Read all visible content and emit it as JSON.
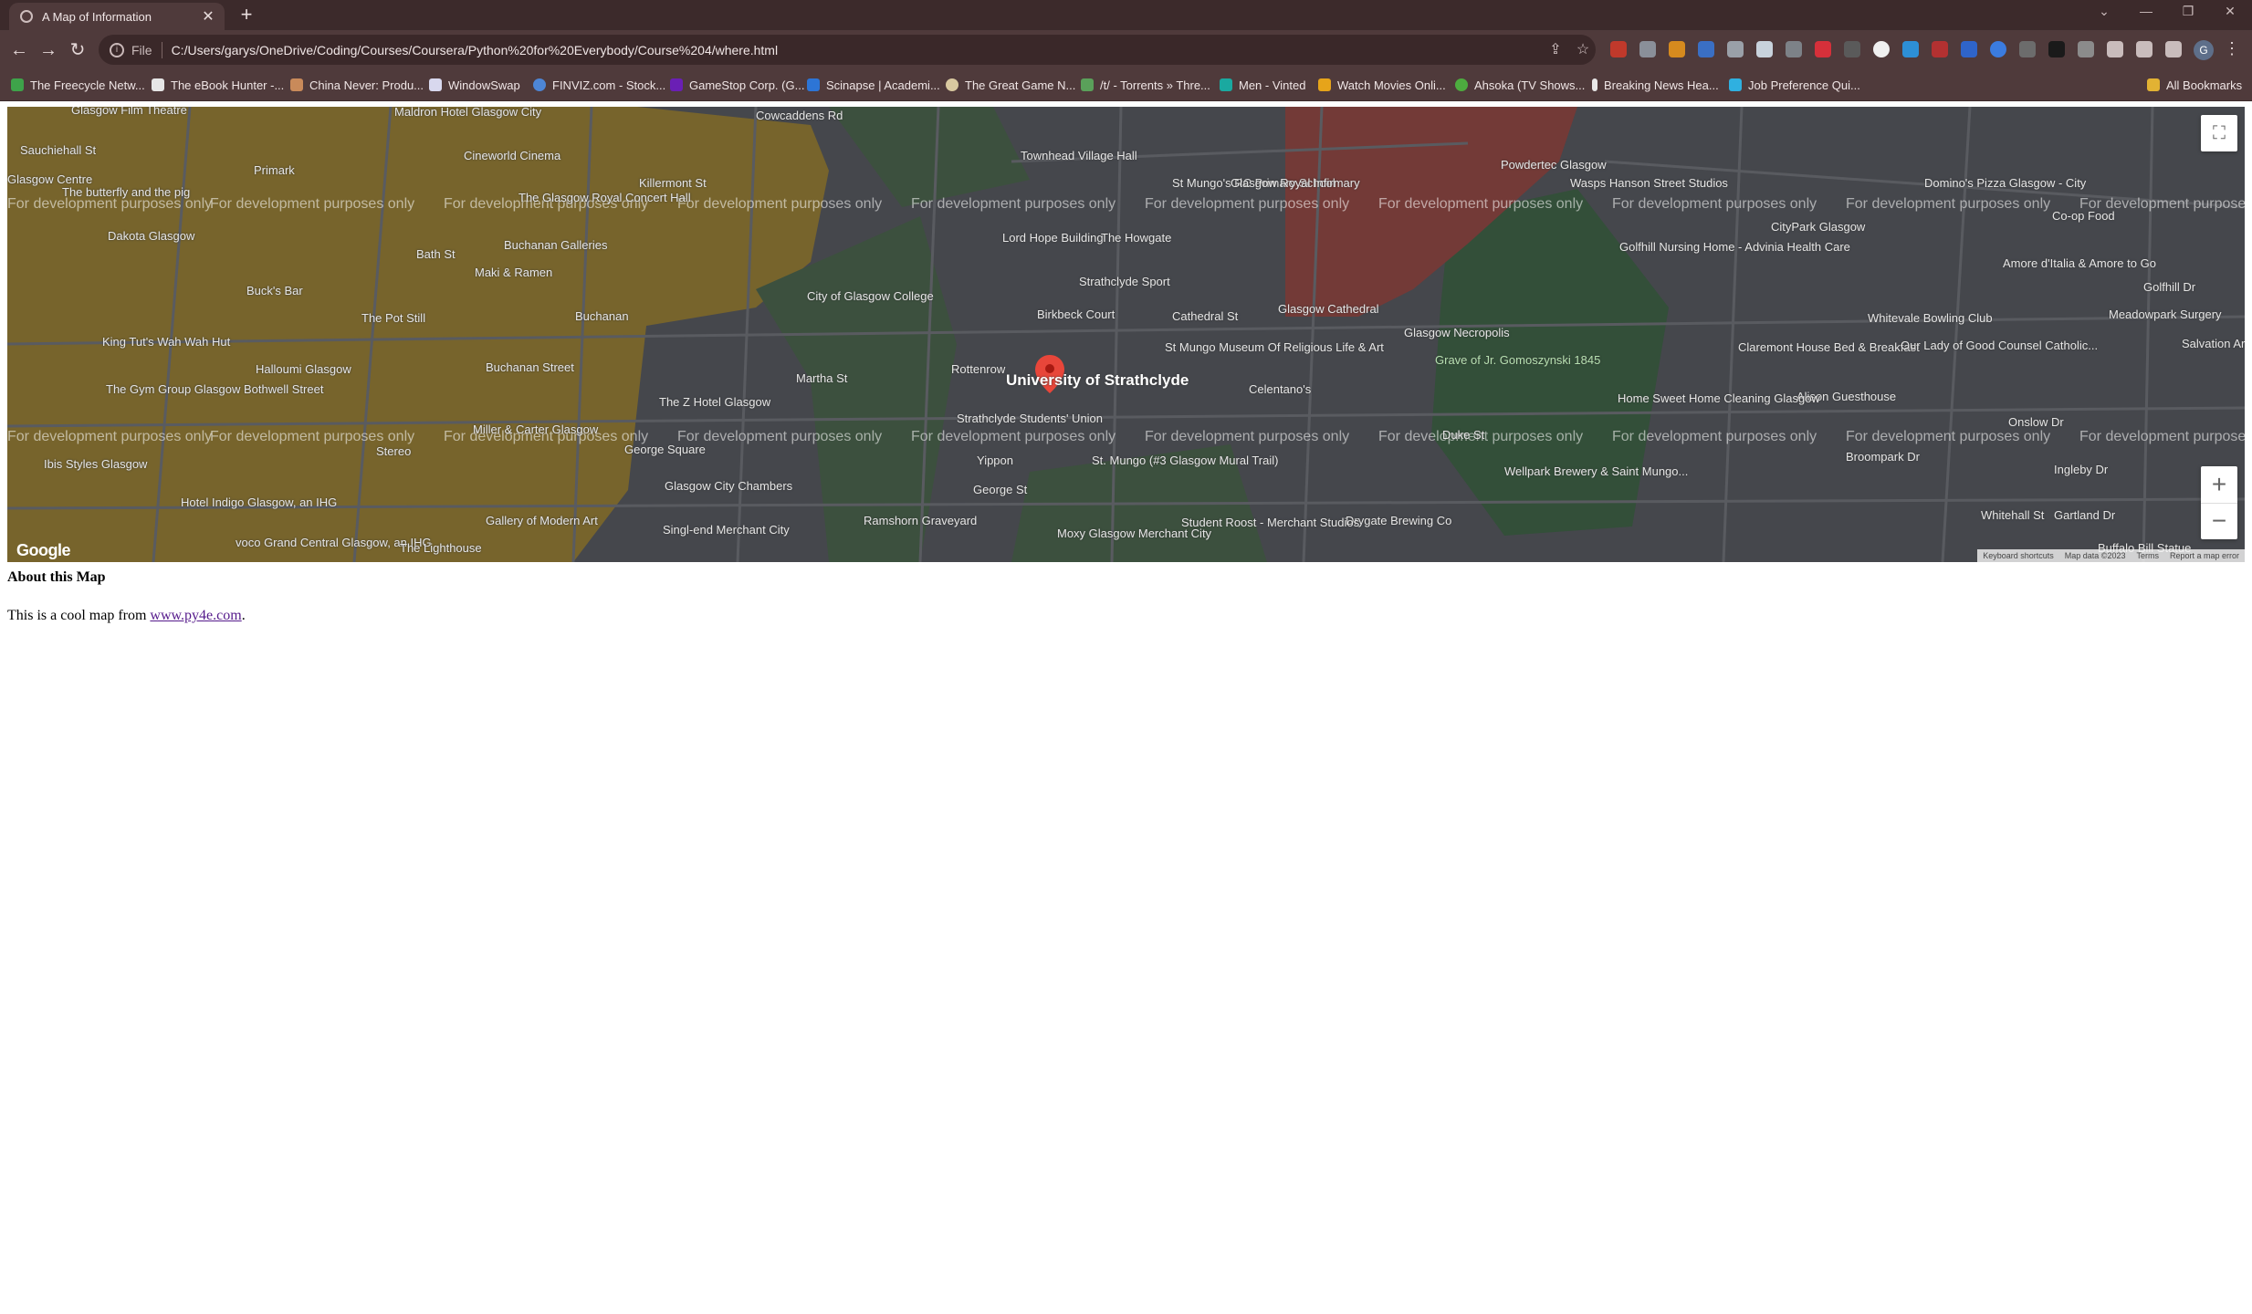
{
  "browser": {
    "tab_title": "A Map of Information",
    "omnibox": {
      "scheme_label": "File",
      "url": "C:/Users/garys/OneDrive/Coding/Courses/Coursera/Python%20for%20Everybody/Course%204/where.html"
    },
    "bookmarks": [
      "The Freecycle Netw...",
      "The eBook Hunter -...",
      "China Never: Produ...",
      "WindowSwap",
      "FINVIZ.com - Stock...",
      "GameStop Corp. (G...",
      "Scinapse | Academi...",
      "The Great Game N...",
      "/t/ - Torrents » Thre...",
      "Men - Vinted",
      "Watch Movies Onli...",
      "Ahsoka (TV Shows...",
      "Breaking News Hea...",
      "Job Preference Qui..."
    ],
    "all_bookmarks": "All Bookmarks",
    "profile_initial": "G"
  },
  "map": {
    "watermark": "For development purposes only",
    "center_label": "University of Strathclyde",
    "labels": [
      "Glasgow Film Theatre",
      "Maldron Hotel Glasgow City",
      "Cowcaddens Rd",
      "Sauchiehall St",
      "Cineworld Cinema",
      "Primark",
      "Glasgow Centre",
      "The butterfly and the pig",
      "The Glasgow Royal Concert Hall",
      "Killermont St",
      "Buchanan Galleries",
      "Dakota Glasgow",
      "Bath St",
      "Maki & Ramen",
      "Buck's Bar",
      "The Pot Still",
      "Buchanan",
      "King Tut's Wah Wah Hut",
      "Halloumi Glasgow",
      "Buchanan Street",
      "The Gym Group Glasgow Bothwell Street",
      "Miller & Carter Glasgow",
      "George Square",
      "Ibis Styles Glasgow",
      "Stereo",
      "Glasgow City Chambers",
      "Hotel Indigo Glasgow, an IHG",
      "Gallery of Modern Art",
      "Singl-end Merchant City",
      "voco Grand Central Glasgow, an IHG",
      "The Lighthouse",
      "Ramshorn Graveyard",
      "The Z Hotel Glasgow",
      "Martha St",
      "City of Glasgow College",
      "Townhead Village Hall",
      "Lord Hope Building",
      "The Howgate",
      "Strathclyde Sport",
      "Birkbeck Court",
      "Cathedral St",
      "St Mungo Museum Of Religious Life & Art",
      "St Mungo's RC Primary School",
      "Glasgow Royal Infirmary",
      "Glasgow Cathedral",
      "Glasgow Necropolis",
      "Celentano's",
      "Grave of Jr. Gomoszynski 1845",
      "Wasps Hanson Street Studios",
      "Powdertec Glasgow",
      "Golfhill Nursing Home - Advinia Health Care",
      "Whitevale Bowling Club",
      "Domino's Pizza Glasgow - City",
      "CityPark Glasgow",
      "Amore d'Italia & Amore to Go",
      "Meadowpark Surgery",
      "Salvation Army",
      "Claremont House Bed & Breakfast",
      "Our Lady of Good Counsel Catholic...",
      "Alison Guesthouse",
      "Home Sweet Home Cleaning Glasgow",
      "Wellpark Brewery & Saint Mungo...",
      "Drygate Brewing Co",
      "Student Roost - Merchant Studios",
      "Moxy Glasgow Merchant City",
      "St. Mungo (#3 Glasgow Mural Trail)",
      "Yippon",
      "Strathclyde Students' Union",
      "Rottenrow",
      "George St",
      "Duke St",
      "Buffalo Bill Statue",
      "Gartland Dr",
      "Ingleby Dr",
      "Onslow Dr",
      "Broompark Dr",
      "Whitehall St",
      "Golfhill Dr",
      "Co-op Food"
    ],
    "zoom_in": "+",
    "zoom_out": "−",
    "fullscreen_icon": "fullscreen-icon",
    "google_logo": "Google",
    "footer": {
      "shortcuts": "Keyboard shortcuts",
      "data": "Map data ©2023",
      "terms": "Terms",
      "report": "Report a map error"
    }
  },
  "content": {
    "heading": "About this Map",
    "about_prefix": "This is a cool map from ",
    "about_link": "www.py4e.com",
    "about_suffix": "."
  }
}
